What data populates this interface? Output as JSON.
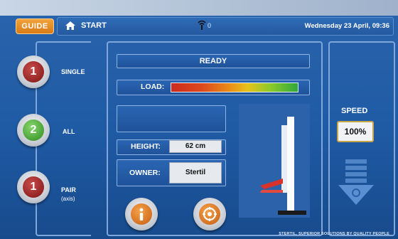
{
  "header": {
    "guide_label": "GUIDE",
    "start_label": "START",
    "signal_count": "0",
    "datetime": "Wednesday 23 April, 09:36"
  },
  "modes": [
    {
      "label": "SINGLE",
      "glyph": "1",
      "color": "red"
    },
    {
      "label": "ALL",
      "glyph": "2",
      "color": "green"
    },
    {
      "label": "PAIR",
      "sublabel": "(axis)",
      "glyph": "1",
      "color": "red"
    }
  ],
  "status": {
    "ready_text": "READY",
    "load_label": "LOAD:",
    "height_label": "HEIGHT:",
    "height_value": "62 cm",
    "owner_label": "OWNER:",
    "owner_value": "Stertil"
  },
  "speed": {
    "label": "SPEED",
    "value": "100%"
  },
  "footer": {
    "tagline": "STERTIL, SUPERIOR SOLUTIONS BY QUALITY PEOPLE"
  },
  "colors": {
    "accent_orange": "#d97b17",
    "panel_blue": "#1f5aa4",
    "ready_green": "#2d8a1f",
    "mode_red": "#7d1515"
  },
  "icons": {
    "home": "home-icon",
    "signal": "signal-icon",
    "info": "info-icon",
    "lift": "lift-diagram-icon",
    "down": "down-arrow-icon"
  }
}
